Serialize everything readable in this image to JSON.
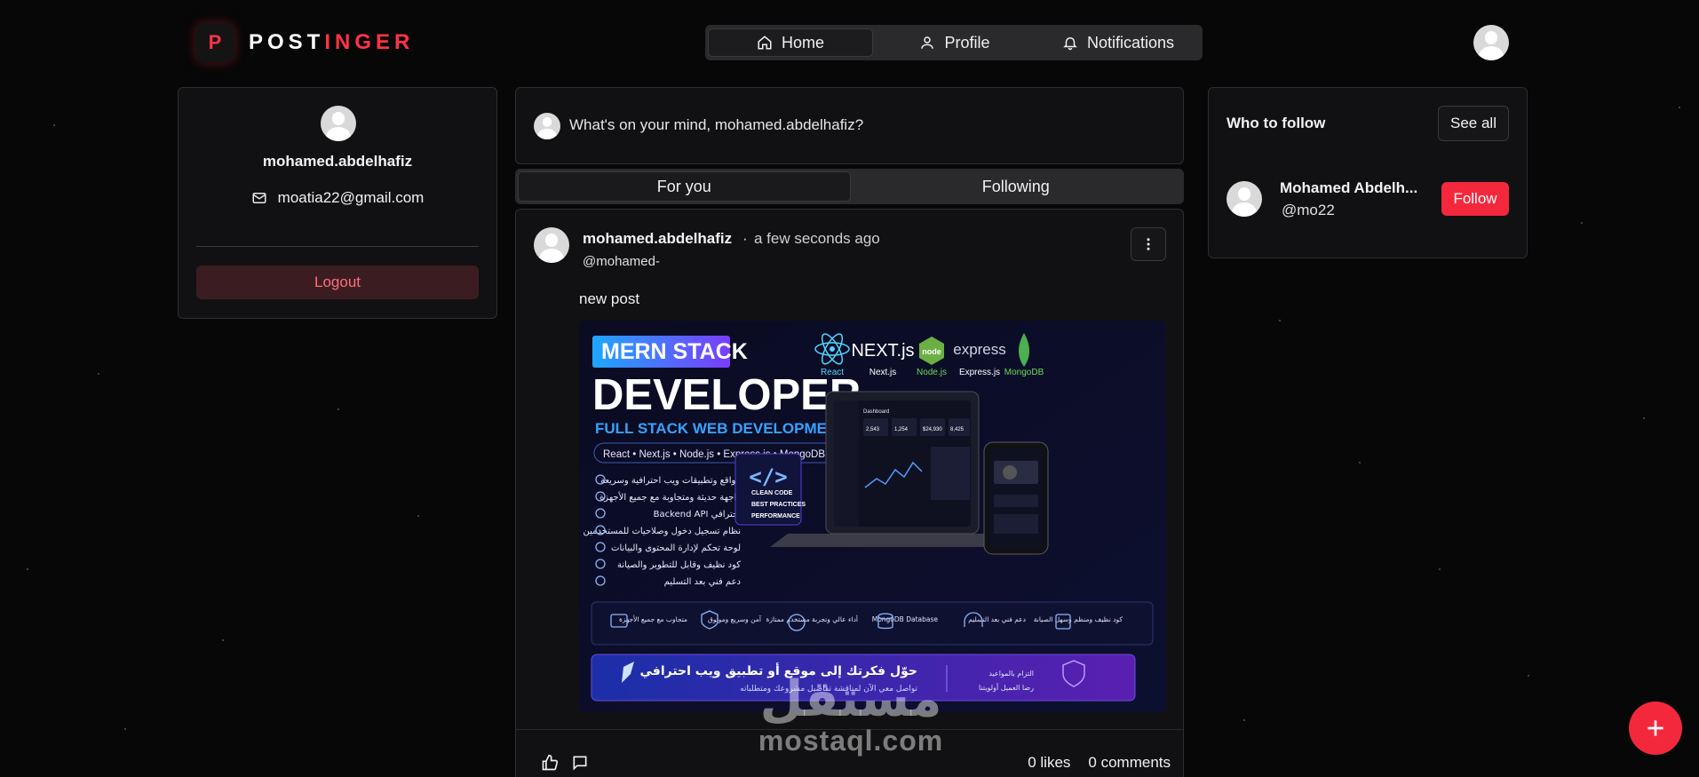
{
  "brand": {
    "mark": "P",
    "name_part1": "POST",
    "name_part2": "INGER",
    "accent": "#ff3347"
  },
  "nav": [
    {
      "label": "Home",
      "icon": "home-icon",
      "active": true
    },
    {
      "label": "Profile",
      "icon": "user-icon",
      "active": false
    },
    {
      "label": "Notifications",
      "icon": "bell-icon",
      "active": false
    }
  ],
  "sidebar": {
    "username": "mohamed.abdelhafiz",
    "email": "moatia22@gmail.com",
    "logout_label": "Logout"
  },
  "composer": {
    "placeholder": "What's on your mind, mohamed.abdelhafiz?"
  },
  "feed_tabs": [
    {
      "label": "For you",
      "active": true
    },
    {
      "label": "Following",
      "active": false
    }
  ],
  "post": {
    "author": "mohamed.abdelhafiz",
    "separator": "·",
    "time": "a few seconds ago",
    "handle": "@mohamed-",
    "text": "new post",
    "likes": "0 likes",
    "comments": "0 comments",
    "image": {
      "badge": "MERN STACK",
      "title": "DEVELOPER",
      "subtitle": "FULL STACK WEB DEVELOPMENT",
      "stack_line": "React • Next.js • Node.js • Express.js • MongoDB",
      "tech": [
        "React",
        "Next.js",
        "Node.js",
        "Express.js",
        "MongoDB"
      ],
      "features": [
        "مواقع وتطبيقات ويب احترافية وسريعة",
        "واجهة حديثة ومتجاوبة مع جميع الأجهزة",
        "Backend API احترافي",
        "نظام تسجيل دخول وصلاحيات للمستخدمين",
        "لوحة تحكم لإدارة المحتوى والبيانات",
        "كود نظيف وقابل للتطوير والصيانة",
        "دعم فني بعد التسليم"
      ],
      "code_box": [
        "CLEAN CODE",
        "BEST PRACTICES",
        "PERFORMANCE"
      ],
      "dashboard_title": "Dashboard",
      "stats": [
        "2,543",
        "1,254",
        "$24,930",
        "8,425"
      ],
      "bottom_icons": [
        "متجاوب مع جميع الأجهزة",
        "آمن وسريع وموثوق",
        "أداء عالي وتجربة مستخدم ممتازة",
        "MongoDB Database",
        "دعم فني بعد التسليم",
        "كود نظيف ومنظم وسهل الصيانة"
      ],
      "banner_main": "حوّل فكرتك إلى موقع أو تطبيق ويب احترافي",
      "banner_sub": "تواصل معي الآن لمناقشة تفاصيل مشروعك ومتطلباته",
      "banner_right1": "التزام بالمواعيد",
      "banner_right2": "رضا العميل أولويتنا"
    }
  },
  "who_to_follow": {
    "title": "Who to follow",
    "see_all_label": "See all",
    "users": [
      {
        "name": "Mohamed Abdelh...",
        "handle": "@mo22",
        "follow_label": "Follow"
      }
    ]
  },
  "watermark": {
    "arabic": "مستقل",
    "latin": "mostaql.com"
  }
}
